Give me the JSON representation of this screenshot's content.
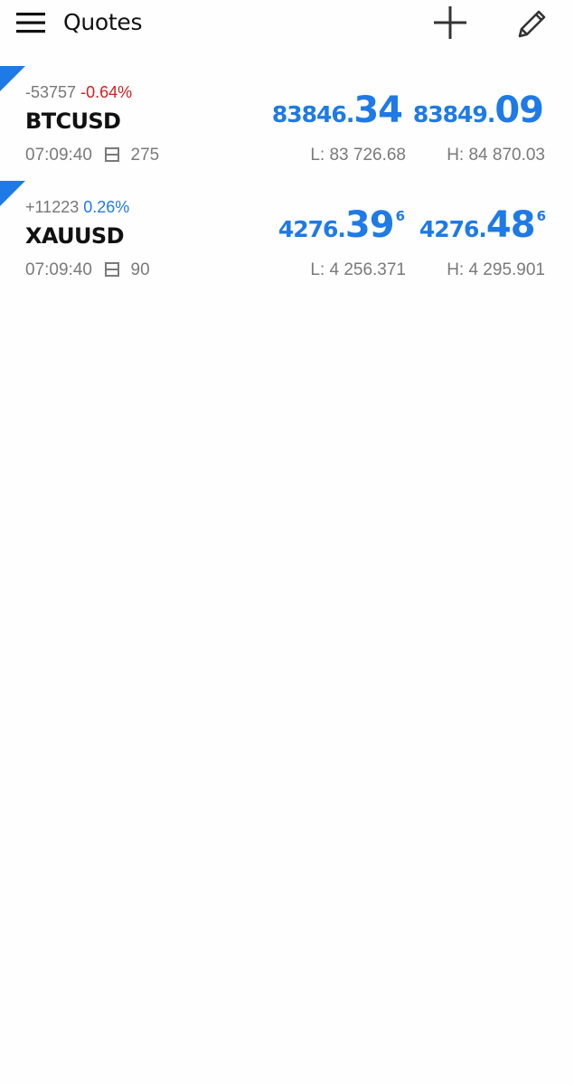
{
  "header": {
    "title": "Quotes",
    "icons": {
      "menu": "hamburger-menu-icon",
      "add": "plus-icon",
      "edit": "pencil-icon"
    }
  },
  "colors": {
    "accent": "#1e7ae6",
    "negative": "#d21e1e",
    "muted": "#7a7a7a"
  },
  "quotes": [
    {
      "change_points": "-53757",
      "change_percent": "-0.64%",
      "direction": "down",
      "symbol": "BTCUSD",
      "time": "07:09:40",
      "spread": "275",
      "bid": {
        "small": "83846.",
        "big": "34",
        "sup": ""
      },
      "ask": {
        "small": "83849.",
        "big": "09",
        "sup": ""
      },
      "low": "L: 83 726.68",
      "high": "H: 84 870.03"
    },
    {
      "change_points": "+11223",
      "change_percent": "0.26%",
      "direction": "up",
      "symbol": "XAUUSD",
      "time": "07:09:40",
      "spread": "90",
      "bid": {
        "small": "4276.",
        "big": "39",
        "sup": "6"
      },
      "ask": {
        "small": "4276.",
        "big": "48",
        "sup": "6"
      },
      "low": "L: 4 256.371",
      "high": "H: 4 295.901"
    }
  ]
}
